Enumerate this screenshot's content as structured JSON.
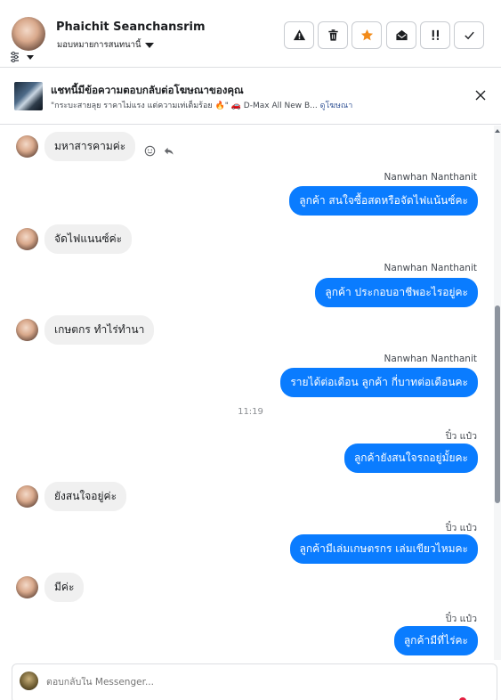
{
  "header": {
    "contact_name": "Phaichit Seanchansrim",
    "assign_label": "มอบหมายการสนทนานี้",
    "tools": [
      {
        "name": "report-button",
        "icon": "warning-icon"
      },
      {
        "name": "delete-button",
        "icon": "trash-icon"
      },
      {
        "name": "star-button",
        "icon": "star-icon",
        "color": "#f28b1a"
      },
      {
        "name": "mark-unread-button",
        "icon": "envelope-open-icon"
      },
      {
        "name": "follow-up-button",
        "icon": "exclaim-icon"
      },
      {
        "name": "mark-done-button",
        "icon": "check-icon"
      }
    ]
  },
  "ad": {
    "title": "แชทนี้มีข้อความตอบกลับต่อโฆษณาของคุณ",
    "ad_text": "\"กระบะสายลุย ราคาไม่แรง แต่ความเท่เต็มร้อย 🔥\" 🚗 D-Max All New B...",
    "view_ad_link": "ดูโฆษณา"
  },
  "messages": {
    "m1": "มหาสารคามค่ะ",
    "s2": "Nanwhan Nanthanit",
    "m2": "ลูกค้า สนใจซื้อสดหรือจัดไฟแน้นซ์คะ",
    "m3": "จัดไฟแนนซ์ค่ะ",
    "s4": "Nanwhan Nanthanit",
    "m4": "ลูกค้า ประกอบอาชีพอะไรอยู่คะ",
    "m5": "เกษตกร ทำไร่ทำนา",
    "s6": "Nanwhan Nanthanit",
    "m6": "รายได้ต่อเดือน ลูกค้า กี่บาทต่อเดือนคะ",
    "time": "11:19",
    "s7": "ปิ๋ว แป๋ว",
    "m7": "ลูกค้ายังสนใจรถอยู่มั้ยคะ",
    "m8": "ยังสนใจอยู่ค่ะ",
    "s9": "ปิ๋ว แป๋ว",
    "m9": "ลูกค้ามีเล่มเกษตรกร เล่มเขียวไหมคะ",
    "m10": "มีค่ะ",
    "s11": "ปิ๋ว แป๋ว",
    "m11": "ลูกค้ามีที่ไร่คะ"
  },
  "composer": {
    "placeholder": "ตอบกลับใน Messenger..."
  },
  "colors": {
    "outgoing_bubble": "#0a7cff",
    "incoming_bubble": "#f0f0f0",
    "star": "#f28b1a"
  }
}
